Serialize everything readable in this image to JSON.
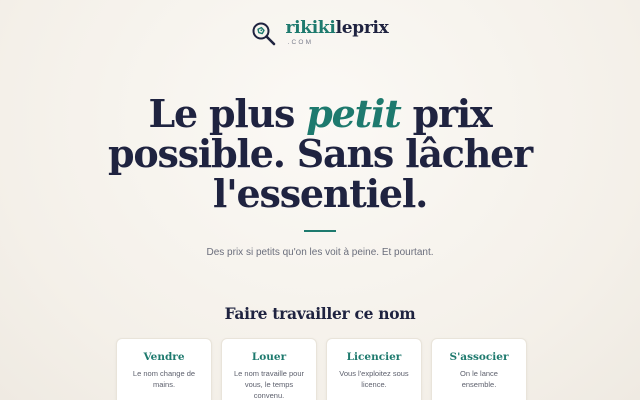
{
  "logo": {
    "name_part1": "rikiki",
    "name_part2": "leprix",
    "tld": ".COM",
    "icon": "magnifier-tag-icon"
  },
  "hero": {
    "line1_start": "Le plus ",
    "line1_accent": "petit",
    "line1_end": " prix",
    "line2": "possible. Sans lâcher",
    "line3": "l'essentiel."
  },
  "subtitle": "Des prix si petits qu'on les voit à peine. Et pourtant.",
  "section": {
    "title": "Faire travailler ce nom",
    "cards": [
      {
        "title": "Vendre",
        "desc": "Le nom change de mains."
      },
      {
        "title": "Louer",
        "desc": "Le nom travaille pour vous, le temps convenu."
      },
      {
        "title": "Licencier",
        "desc": "Vous l'exploitez sous licence."
      },
      {
        "title": "S'associer",
        "desc": "On le lance ensemble."
      }
    ]
  },
  "colors": {
    "accent": "#1e7a6e",
    "text": "#1f2340",
    "background": "#f4f0e9"
  }
}
